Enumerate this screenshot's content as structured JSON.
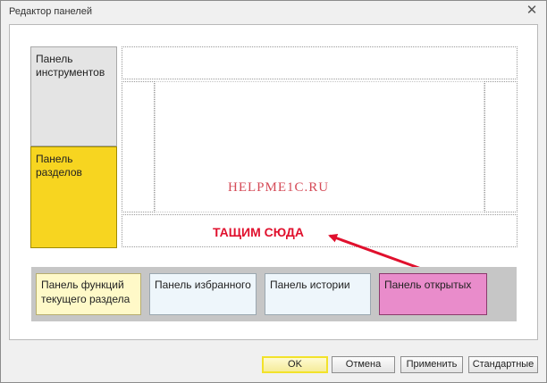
{
  "window": {
    "title": "Редактор панелей",
    "close_glyph": "✕"
  },
  "panels": {
    "toolbar_panel": "Панель инструментов",
    "sections_panel": "Панель разделов"
  },
  "overlay": {
    "watermark": "HELPME1C.RU",
    "drag_instruction": "ТАЩИМ СЮДА",
    "arrow_color": "#e0102d"
  },
  "available_panels": [
    {
      "label": "Панель функций текущего раздела",
      "color": "#fff9c8"
    },
    {
      "label": "Панель избранного",
      "color": "#eef6fb"
    },
    {
      "label": "Панель истории",
      "color": "#eef6fb"
    },
    {
      "label": "Панель открытых",
      "color": "#e98ccb"
    }
  ],
  "buttons": {
    "ok": "OK",
    "cancel": "Отмена",
    "apply": "Применить",
    "standard": "Стандартные"
  },
  "colors": {
    "sections_panel": "#f7d520",
    "toolbar_panel": "#e4e4e4",
    "ok_highlight": "#f2e22a"
  }
}
